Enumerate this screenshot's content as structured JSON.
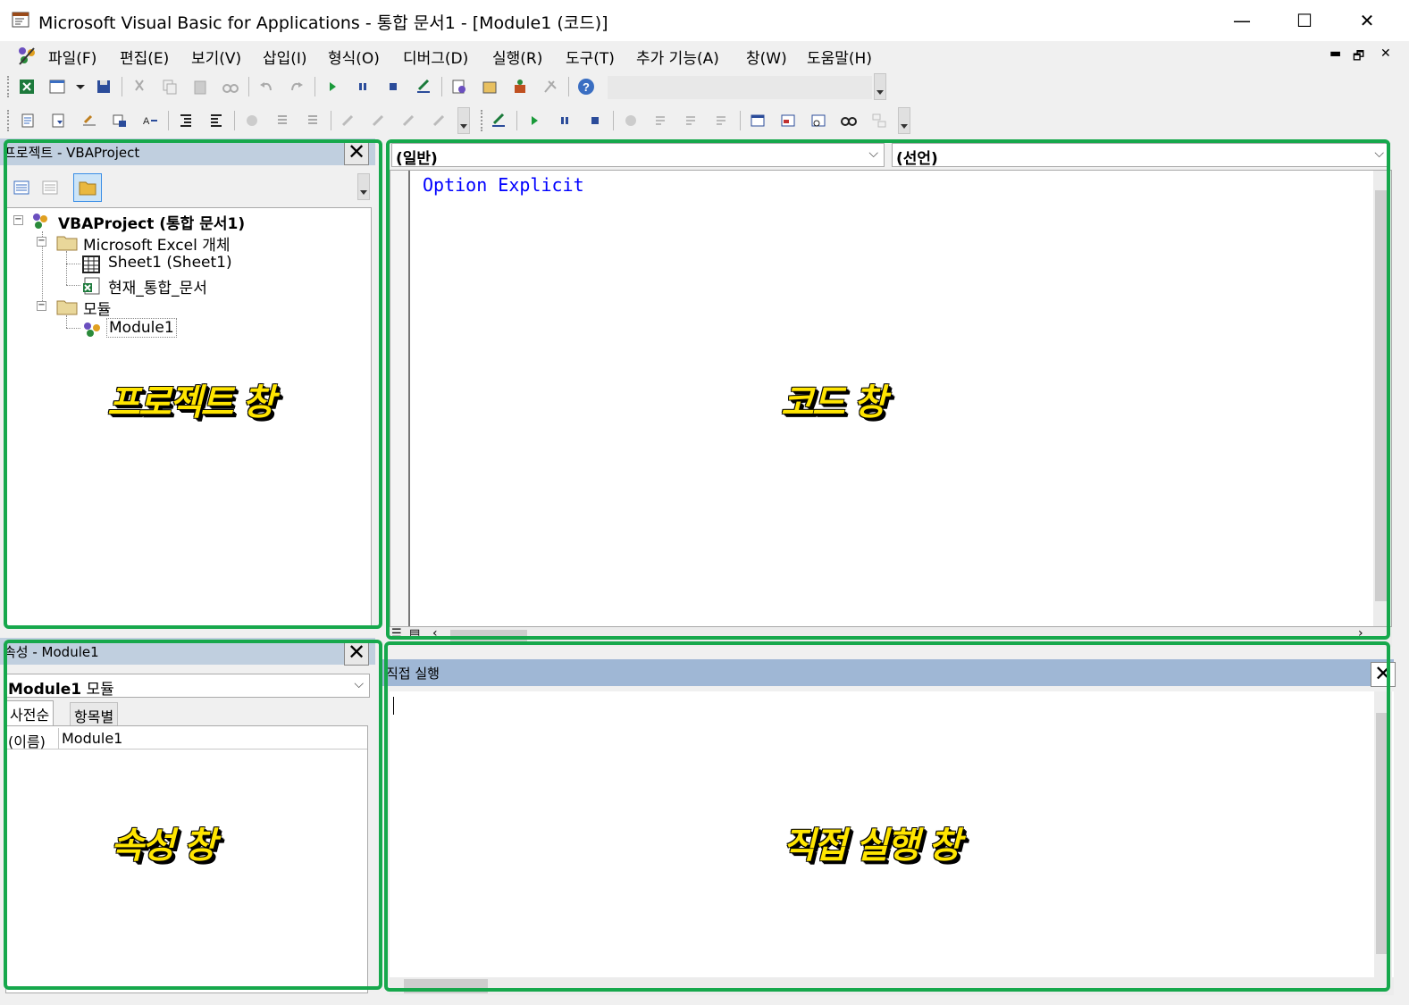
{
  "window": {
    "title": "Microsoft Visual Basic for Applications - 통합 문서1 - [Module1 (코드)]",
    "minimize": "—",
    "maximize": "☐",
    "close": "✕"
  },
  "menu": {
    "items": [
      "파일(F)",
      "편집(E)",
      "보기(V)",
      "삽입(I)",
      "형식(O)",
      "디버그(D)",
      "실행(R)",
      "도구(T)",
      "추가 기능(A)",
      "창(W)",
      "도움말(H)"
    ],
    "mdi_minimize": "▬",
    "mdi_restore": "🗗",
    "mdi_close": "✕"
  },
  "project_pane": {
    "title": "프로젝트 - VBAProject",
    "close": "✕",
    "tree": {
      "root": "VBAProject (통합 문서1)",
      "excel_objects_folder": "Microsoft Excel 개체",
      "sheet1": "Sheet1 (Sheet1)",
      "thisworkbook": "현재_통합_문서",
      "modules_folder": "모듈",
      "module1": "Module1"
    }
  },
  "properties_pane": {
    "title": "속성 - Module1",
    "close": "✕",
    "object_combo_bold": "Module1",
    "object_combo_rest": " 모듈",
    "tab_alpha": "사전순",
    "tab_category": "항목별",
    "prop_name": "(이름)",
    "prop_value": "Module1"
  },
  "code_pane": {
    "object_combo": "(일반)",
    "proc_combo": "(선언)",
    "code_line": "Option Explicit"
  },
  "immediate_pane": {
    "title": "직접 실행",
    "close": "✕"
  },
  "annotations": {
    "project": "프로젝트 창",
    "code": "코드 창",
    "properties": "속성 창",
    "immediate": "직접 실행 창"
  },
  "colors": {
    "annotation_frame": "#16a84c",
    "annotation_text": "#ffe500",
    "code_keyword": "#0000ff",
    "pane_title_bg": "#c0cfdf"
  }
}
